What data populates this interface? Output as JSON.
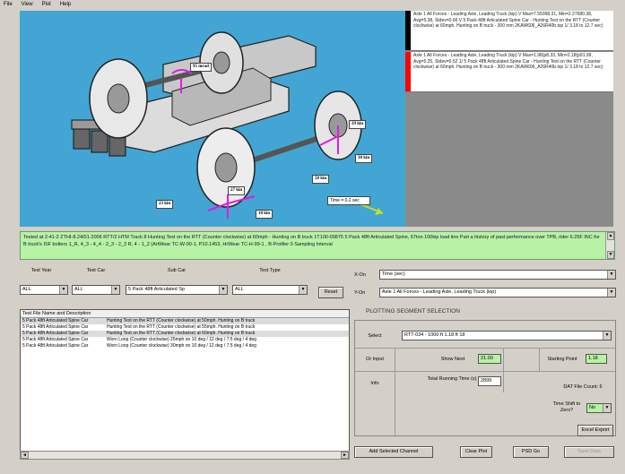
{
  "menu": [
    "File",
    "View",
    "Plot",
    "Help"
  ],
  "viz": {
    "callouts": [
      {
        "label": "95 mrad"
      },
      {
        "label": "29 kin"
      },
      {
        "label": "30 kin"
      },
      {
        "label": "58 kin"
      },
      {
        "label": "27 kin"
      },
      {
        "label": "23 kin"
      },
      {
        "label": "10 kin"
      }
    ],
    "time_label": "Time = 0.2 sec"
  },
  "channels": [
    {
      "color": "#000000",
      "text": "Axle 1 All Forces - Leading Axle, Leading Truck (kip) V Max=7.55098.31, Min=2.27680.38, Avg=5.38, Stdev=0.66 V 5 Pack 48ft Articulated Spine Car - Hunting Test on the RTT (Counter clockwise) at 60mph. Hunting on B truck - 300 mm 2KAW606_A26R40b.tsp 1/ 3.18 to 12.7 sec)"
    },
    {
      "color": "#ff0000",
      "text": "Axle 1 All Forces - Leading Axle, Leading Truck (kip) V Max=1.98(p8.33, Min=2.18(p91.99, Avg=5.25, Stdev=0.52 1/ 5 Pack 48ft Articulated Spine Car - Hunting Test on the RTT (Counter clockwise) at 60mph. Hunting on B truck - 300 mm 2KAW606_A26R40b.tsp 1/ 3.18 to 12.7 sec)"
    }
  ],
  "status_text": "Tested at 2-41-2 ZTHI-8.24/01-2006 RTT/2 HTM Track 8 Hunting Test on the RTT (Counter clockwise) at 60mph - Hunting on B truck 1T100-00875 5 Pack 48ft Articulated Spine, 67ton 100kip load line Part a history of past performance over TPB, rider 6.25F INC for B truck's ISF bolters 1_R, 4_3 - 4_4 - 2_3 - 2_3 R, 4 - 1_2 (ArtWear TC-W-00-1, P10.1453, HrWear TC-H-99-1 , B-Profiler 0 Sampling Interval",
  "filters": [
    {
      "label": "Test Year",
      "value": "ALL"
    },
    {
      "label": "Test Car",
      "value": "ALL"
    },
    {
      "label": "Sub Car",
      "value": "5 Pack 48ft Articulated Sp"
    },
    {
      "label": "Test Type",
      "value": "ALL"
    }
  ],
  "reset_label": "Reset",
  "x_on": {
    "label": "X-On",
    "value": "Time (sec)"
  },
  "y_on": {
    "label": "Y-On",
    "value": "Axle 1 All Forces - Leading Axle, Leading Truck (kip)"
  },
  "list": {
    "header": "Test File Name and Description",
    "rows": [
      {
        "name": "5 Pack 48ft Articulated Spine Car",
        "desc": "Hunting Test on the RTT (Counter clockwise) at 50mph. Hunting on B truck",
        "selected": true
      },
      {
        "name": "5 Pack 48ft Articulated Spine Car",
        "desc": "Hunting Test on the RTT (Counter clockwise) at 55mph. Hunting on B truck",
        "selected": false
      },
      {
        "name": "5 Pack 48ft Articulated Spine Car",
        "desc": "Hunting Test on the RTT (Counter clockwise) at 60mph. Hunting on B truck",
        "selected": true
      },
      {
        "name": "5 Pack 48ft Articulated Spine Car",
        "desc": "Worn Loop (Counter clockwise) 25mph on 10 deg / 12 deg / 7.5 deg / 4 deg",
        "selected": false
      },
      {
        "name": "5 Pack 48ft Articulated Spine Car",
        "desc": "Worn Loop (Counter clockwise) 30mph on 10 deg / 12 deg / 7.5 deg / 4 deg",
        "selected": false
      }
    ]
  },
  "segment": {
    "title": "PLOTTING SEGMENT SELECTION",
    "select_label": "Select",
    "select_value": "RTT-034 - 1000 ft 1.18 ft 18",
    "orinput_label": "Or Input",
    "show_next_label": "Show Next",
    "show_next_value": "21.00",
    "starting_point_label": "Starting Point",
    "starting_point_value": "1.18",
    "info_label": "Info",
    "total_running_label": "Total Running Time (s)",
    "total_running_value": "2899",
    "dat_file_count": "DAT File Count: 6",
    "time_shift_label": "Time Shift to Zero?",
    "time_shift_value": "No",
    "excel_export": "Excel Export"
  },
  "buttons": {
    "add_channel": "Add Selected Channel",
    "clear_plot": "Clear Plot",
    "plot_go": "PSD Go",
    "last_btn": "Save Data"
  }
}
